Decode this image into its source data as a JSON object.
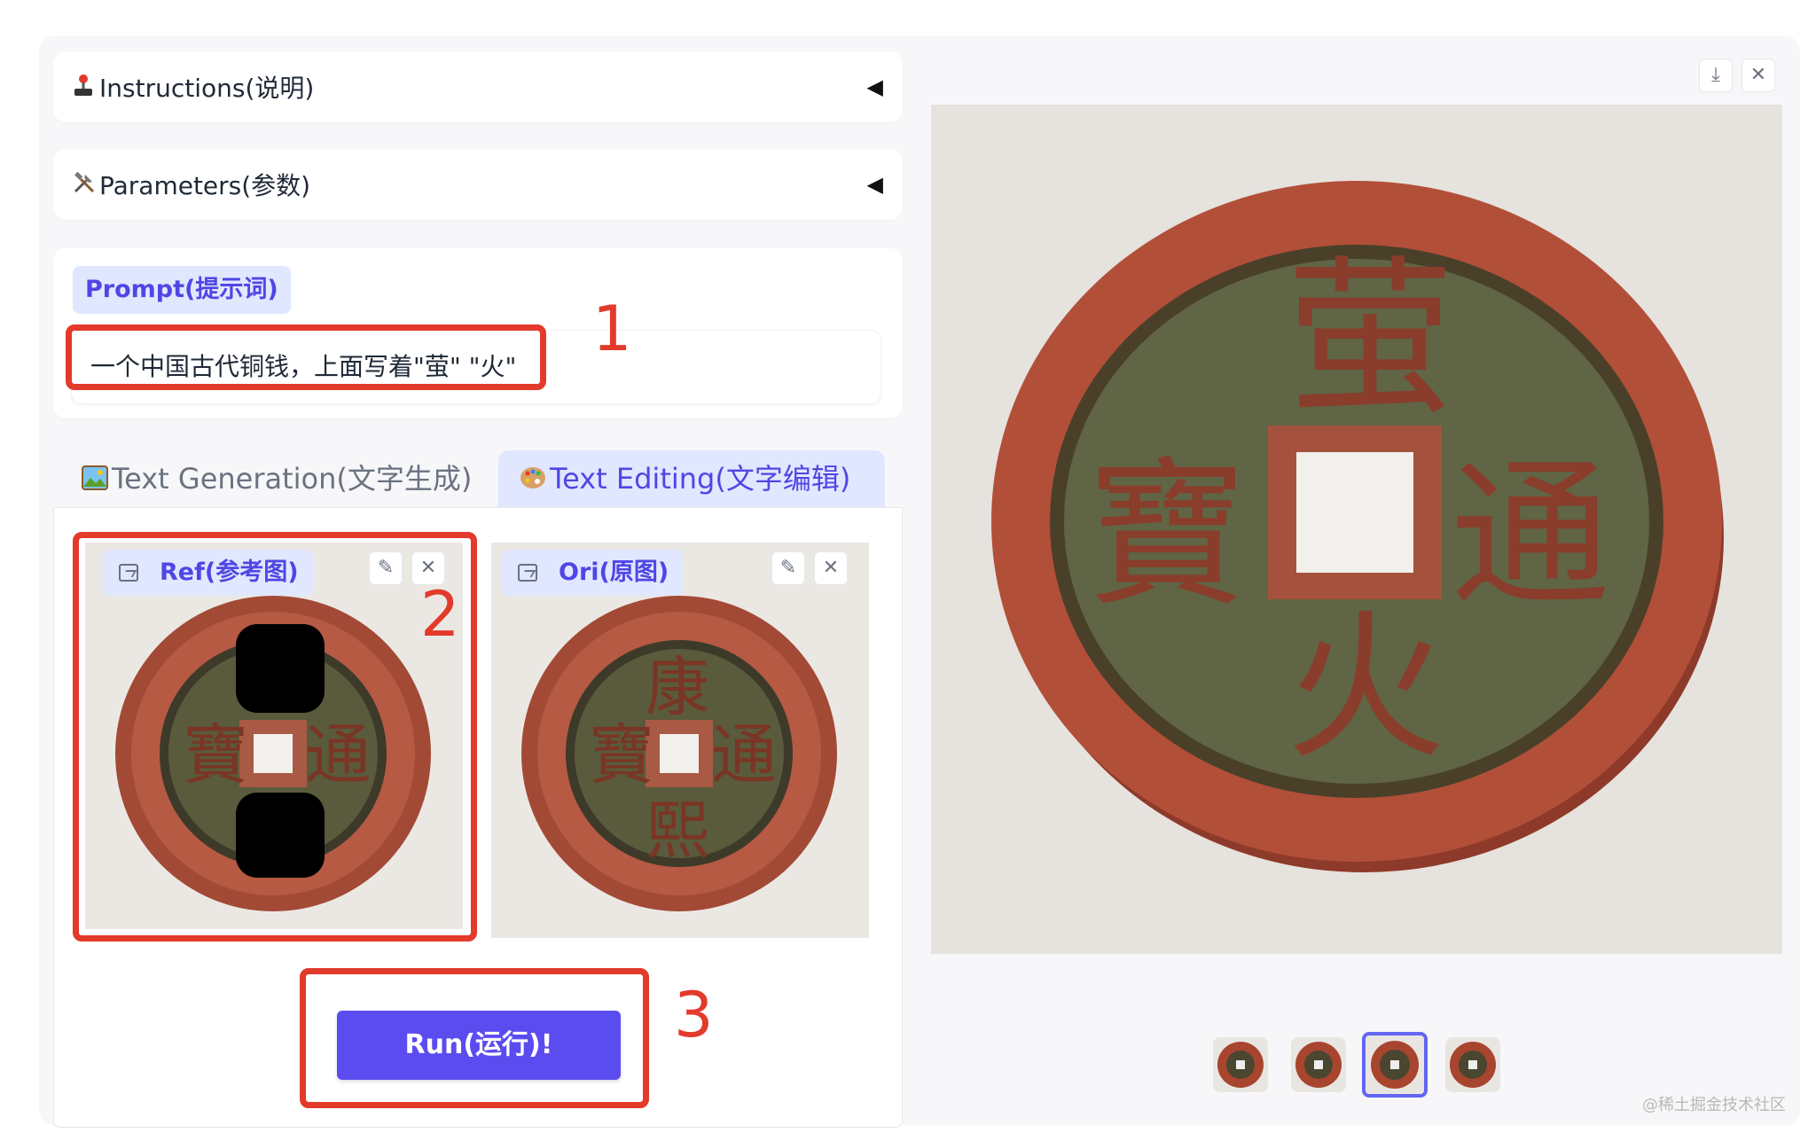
{
  "accordions": {
    "instructions": {
      "icon": "joystick-icon",
      "label": "Instructions(说明)"
    },
    "parameters": {
      "icon": "tools-icon",
      "label": "Parameters(参数)"
    }
  },
  "prompt": {
    "label": "Prompt(提示词)",
    "value": "一个中国古代铜钱，上面写着\"萤\" \"火\""
  },
  "tabs": [
    {
      "label": "Text Generation(文字生成)",
      "icon": "picture-icon",
      "active": false
    },
    {
      "label": "Text Editing(文字编辑)",
      "icon": "palette-icon",
      "active": true
    }
  ],
  "images": {
    "ref": {
      "label": "Ref(参考图)",
      "chars": [
        "寶",
        "通"
      ]
    },
    "ori": {
      "label": "Ori(原图)",
      "chars": [
        "康",
        "寶",
        "通",
        "熙"
      ]
    }
  },
  "run_button": {
    "label": "Run(运行)!"
  },
  "output": {
    "chars": [
      "萤",
      "寶",
      "通",
      "火"
    ],
    "thumbnails_count": 4,
    "selected_thumbnail": 3
  },
  "annotations": {
    "n1": "1",
    "n2": "2",
    "n3": "3"
  },
  "watermark": "@稀土掘金技术社区",
  "colors": {
    "accent": "#4f46e5",
    "accent_bg": "#e0e7ff",
    "run": "#5b4cf0",
    "annotation": "#e23a2b"
  }
}
